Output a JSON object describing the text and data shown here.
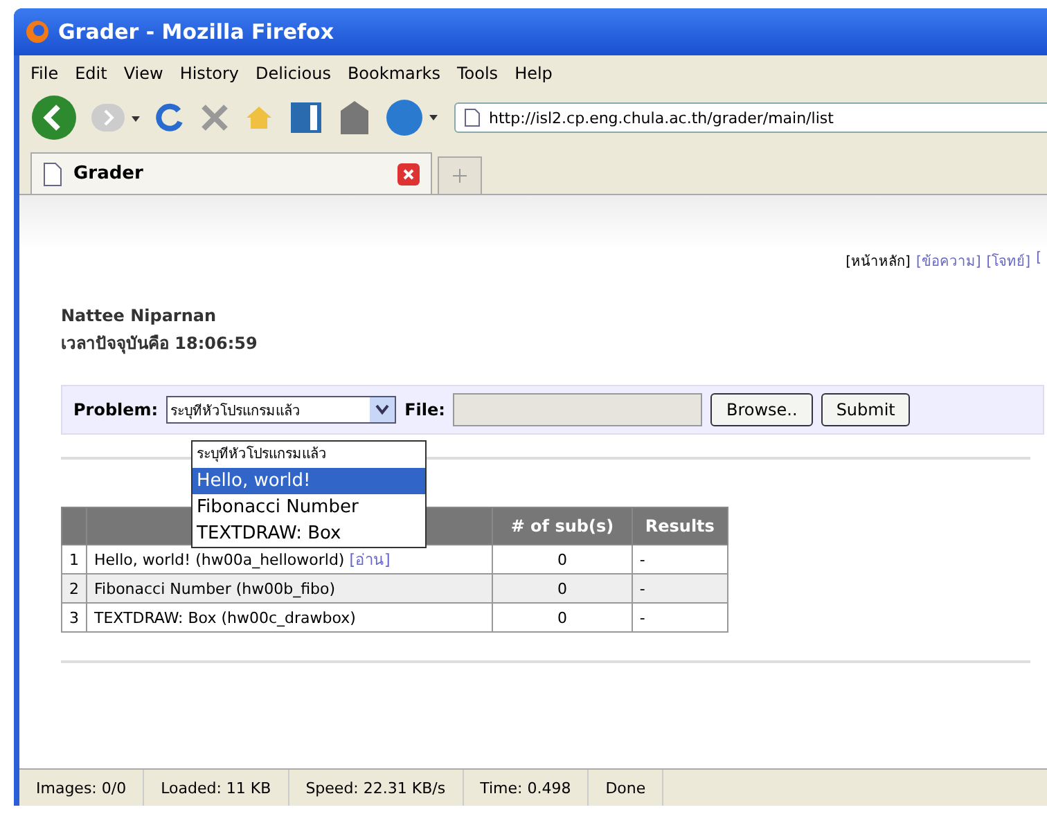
{
  "window": {
    "title": "Grader - Mozilla Firefox"
  },
  "menu": [
    "File",
    "Edit",
    "View",
    "History",
    "Delicious",
    "Bookmarks",
    "Tools",
    "Help"
  ],
  "address": {
    "value": "http://isl2.cp.eng.chula.ac.th/grader/main/list"
  },
  "tabs": [
    {
      "label": "Grader",
      "selected": true
    }
  ],
  "nav_links": [
    {
      "label": "[หน้าหลัก]",
      "selected": true
    },
    {
      "label": "[ข้อความ]",
      "selected": false
    },
    {
      "label": "[โจทย์]",
      "selected": false
    },
    {
      "label": "[",
      "selected": false
    }
  ],
  "user": {
    "name": "Nattee Niparnan",
    "time": "เวลาปัจจุบันคือ 18:06:59"
  },
  "form": {
    "problem_label": "Problem:",
    "problem_value": "ระบุทีหัวโปรแกรมแล้ว",
    "file_label": "File:",
    "browse": "Browse..",
    "submit": "Submit",
    "options": [
      {
        "label": "ระบุทีหัวโปรแกรมแล้ว",
        "selected": false
      },
      {
        "label": "Hello, world!",
        "selected": true
      },
      {
        "label": "Fibonacci Number",
        "selected": false
      },
      {
        "label": "TEXTDRAW: Box",
        "selected": false
      }
    ]
  },
  "table": {
    "columns": [
      "# of sub(s)",
      "Results"
    ],
    "rows": [
      {
        "index": "1",
        "name": "Hello, world! (hw00a_helloworld)",
        "link": "[อ่าน]",
        "subs": "0",
        "result": "-"
      },
      {
        "index": "2",
        "name": "Fibonacci Number (hw00b_fibo)",
        "subs": "0",
        "result": "-"
      },
      {
        "index": "3",
        "name": "TEXTDRAW: Box (hw00c_drawbox)",
        "subs": "0",
        "result": "-"
      }
    ]
  },
  "status_bar": [
    "Images: 0/0",
    "Loaded: 11 KB",
    "Speed: 22.31 KB/s",
    "Time: 0.498",
    "Done"
  ]
}
